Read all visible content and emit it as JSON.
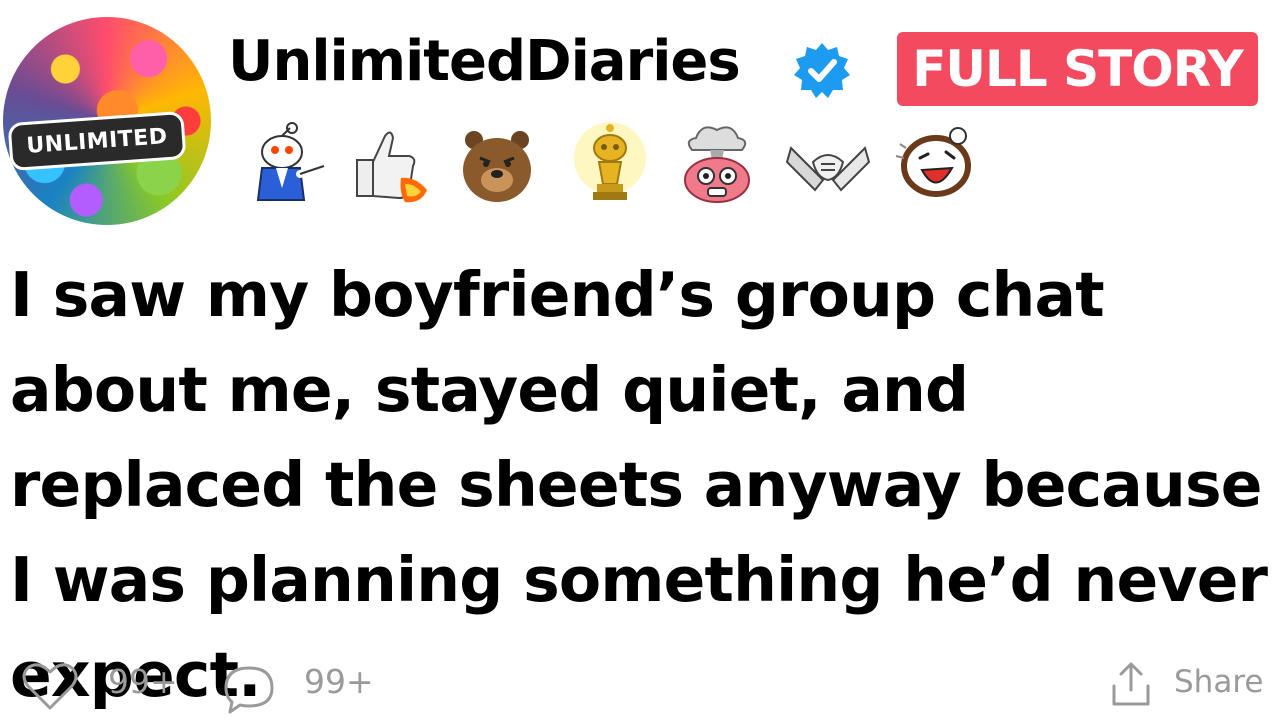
{
  "profile": {
    "avatar_badge": "UNLIMITED",
    "username": "UnlimitedDiaries",
    "verified_icon": "verified-check-icon"
  },
  "header": {
    "full_story_label": "FULL STORY",
    "full_story_color": "#f34a5f",
    "verified_color": "#1d9bf0"
  },
  "reaction_badges": [
    {
      "icon": "pointing-snoo-icon"
    },
    {
      "icon": "thumbs-up-rocket-icon"
    },
    {
      "icon": "bear-icon"
    },
    {
      "icon": "gold-trophy-snoo-icon"
    },
    {
      "icon": "mind-blown-icon"
    },
    {
      "icon": "handshake-icon"
    },
    {
      "icon": "laughing-face-icon"
    }
  ],
  "post": {
    "title": "I saw my boyfriend’s group chat about me, stayed quiet, and replaced the sheets anyway because I was planning something he’d never expect."
  },
  "footer": {
    "likes": "99+",
    "comments": "99+",
    "share_label": "Share",
    "muted_color": "#9a9a9a"
  }
}
